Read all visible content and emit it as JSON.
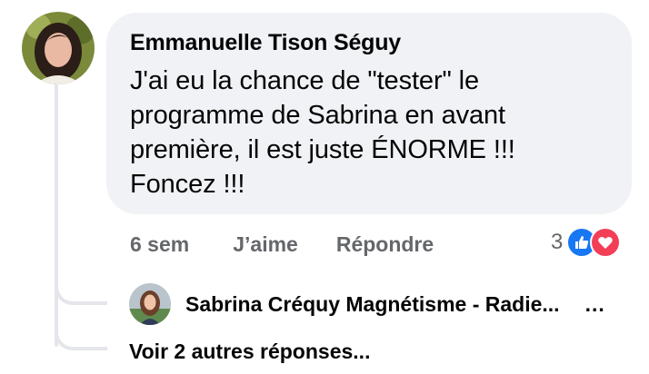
{
  "comment": {
    "author": "Emmanuelle Tison Séguy",
    "text": "J'ai eu la chance de \"tester\" le\nprogramme de Sabrina en avant\npremière, il est juste ÉNORME !!!\nFoncez !!!",
    "time": "6 sem",
    "like_label": "J’aime",
    "reply_label": "Répondre",
    "reaction_count": "3",
    "reactions": [
      "like-icon",
      "love-icon"
    ]
  },
  "reply": {
    "author": "Sabrina Créquy Magnétisme - Radie...",
    "more_dots": "..."
  },
  "more_replies_label": "Voir 2 autres réponses...",
  "colors": {
    "bubble": "#f0f2f5",
    "meta_text": "#65676b",
    "like_blue": "#1877f2",
    "love_red": "#f33e58"
  }
}
